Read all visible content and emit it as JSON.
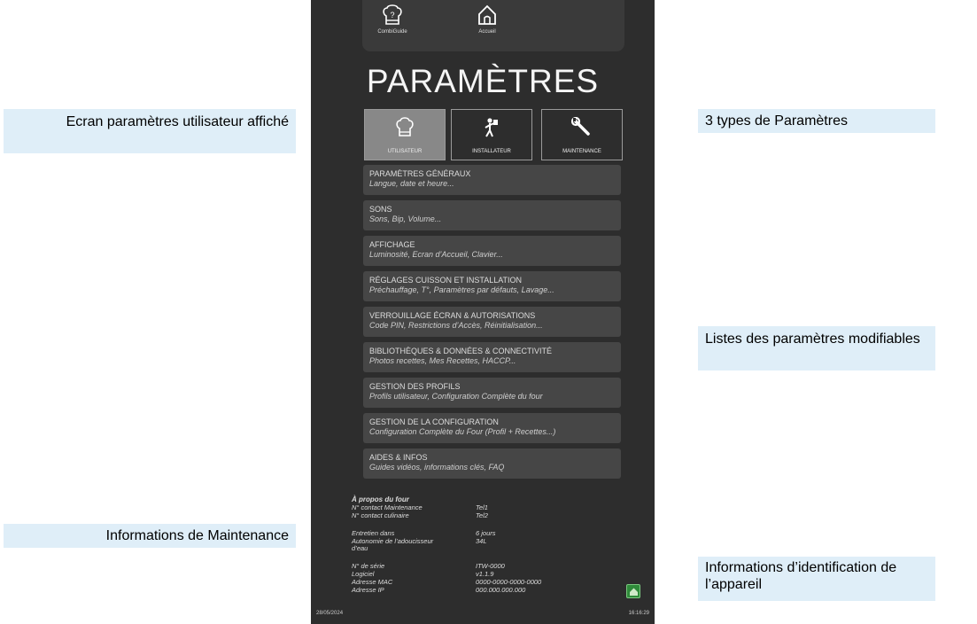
{
  "callouts": {
    "left_top": "Ecran paramètres utilisateur affiché",
    "left_bottom": "Informations de Maintenance",
    "right_top": "3 types de Paramètres",
    "right_middle": "Listes des paramètres modifiables",
    "right_bottom": "Informations d’identification de l’appareil"
  },
  "topbar": {
    "guide_label": "CombiGuide",
    "guide_icon": "chef-hat-question-icon",
    "home_label": "Accueil",
    "home_icon": "home-icon"
  },
  "title": "PARAMÈTRES",
  "tabs": [
    {
      "label": "UTILISATEUR",
      "icon": "chef-hat-icon",
      "active": true
    },
    {
      "label": "INSTALLATEUR",
      "icon": "installer-icon",
      "active": false
    },
    {
      "label": "MAINTENANCE",
      "icon": "wrench-icon",
      "active": false
    }
  ],
  "items": [
    {
      "title": "PARAMÈTRES GÉNÉRAUX",
      "subtitle": "Langue, date et heure..."
    },
    {
      "title": "SONS",
      "subtitle": "Sons, Bip, Volume..."
    },
    {
      "title": "AFFICHAGE",
      "subtitle": "Luminosité, Ecran d’Accueil, Clavier..."
    },
    {
      "title": "RÉGLAGES CUISSON ET INSTALLATION",
      "subtitle": "Préchauffage, T°, Paramètres par défauts, Lavage..."
    },
    {
      "title": "VERROUILLAGE ÉCRAN & AUTORISATIONS",
      "subtitle": "Code PIN, Restrictions d’Accès, Réinitialisation..."
    },
    {
      "title": "BIBLIOTHÈQUES & DONNÉES & CONNECTIVITÉ",
      "subtitle": "Photos recettes, Mes Recettes, HACCP..."
    },
    {
      "title": "GESTION DES PROFILS",
      "subtitle": "Profils utilisateur, Configuration Complète du four"
    },
    {
      "title": "GESTION DE LA CONFIGURATION",
      "subtitle": "Configuration Complète du Four (Profil + Recettes...)"
    },
    {
      "title": "AIDES & INFOS",
      "subtitle": "Guides vidéos, informations clés, FAQ"
    }
  ],
  "about": {
    "heading": "À propos du four",
    "contact_maintenance_label": "N° contact  Maintenance",
    "contact_maintenance_value": "Tel1",
    "contact_culinary_label": "N° contact culinaire",
    "contact_culinary_value": "Tel2",
    "maintenance_label": "Entretien dans",
    "maintenance_value": "6 jours",
    "softener_label": "Autonomie de l’adoucisseur d’eau",
    "softener_value": "34L",
    "serial_label": "N° de série",
    "serial_value": "ITW-0000",
    "software_label": "Logiciel",
    "software_value": "v1.1.9",
    "mac_label": "Adresse MAC",
    "mac_value": "0000-0000-0000-0000",
    "ip_label": "Adresse IP",
    "ip_value": "000.000.000.000"
  },
  "status": {
    "date": "28/05/2024",
    "time": "16:16:29",
    "home_badge_icon": "home-icon",
    "home_badge_color": "#2f8a3a"
  }
}
